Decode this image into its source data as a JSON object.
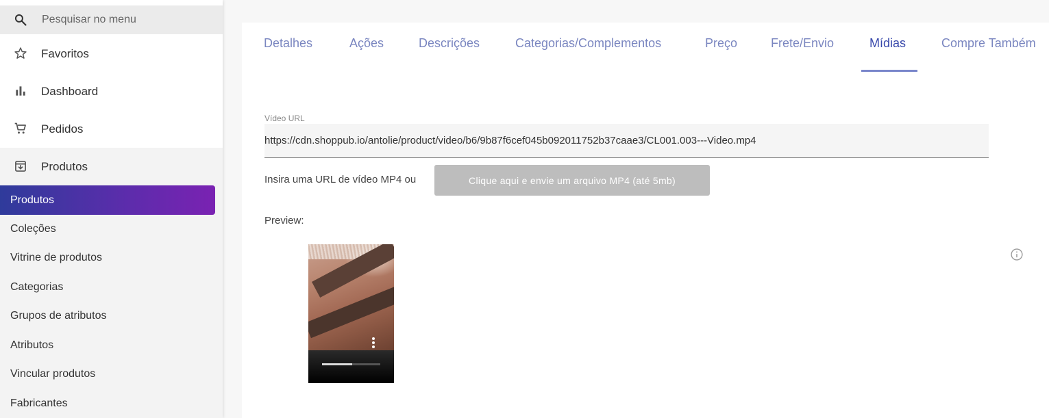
{
  "sidebar": {
    "search": {
      "placeholder": "Pesquisar no menu",
      "icon": "search-icon"
    },
    "items": [
      {
        "label": "Favoritos",
        "icon": "star-icon"
      },
      {
        "label": "Dashboard",
        "icon": "bar-chart-icon"
      },
      {
        "label": "Pedidos",
        "icon": "cart-icon"
      },
      {
        "label": "Produtos",
        "icon": "archive-icon"
      }
    ],
    "subitems": [
      {
        "label": "Produtos",
        "active": true
      },
      {
        "label": "Coleções"
      },
      {
        "label": "Vitrine de produtos"
      },
      {
        "label": "Categorias"
      },
      {
        "label": "Grupos de atributos"
      },
      {
        "label": "Atributos"
      },
      {
        "label": "Vincular produtos"
      },
      {
        "label": "Fabricantes"
      }
    ]
  },
  "tabs": [
    {
      "label": "Detalhes"
    },
    {
      "label": "Ações"
    },
    {
      "label": "Descrições"
    },
    {
      "label": "Categorias/Complementos"
    },
    {
      "label": "Preço"
    },
    {
      "label": "Frete/Envio"
    },
    {
      "label": "Mídias",
      "active": true
    },
    {
      "label": "Compre Também"
    }
  ],
  "media": {
    "video_url_label": "Vídeo URL",
    "video_url_value": "https://cdn.shoppub.io/antolie/product/video/b6/9b87f6cef045b092011752b37caae3/CL001.003---Video.mp4",
    "hint": "Insira uma URL de vídeo MP4 ou",
    "upload_button": "Clique aqui e envie um arquivo MP4 (até 5mb)",
    "preview_label": "Preview:",
    "video_progress": 0.52
  },
  "colors": {
    "accent_start": "#2f3b9b",
    "accent_end": "#7a22b2",
    "tab_text": "#7a86c0",
    "tab_active": "#3949ab",
    "button_disabled": "#bdbdbd"
  }
}
